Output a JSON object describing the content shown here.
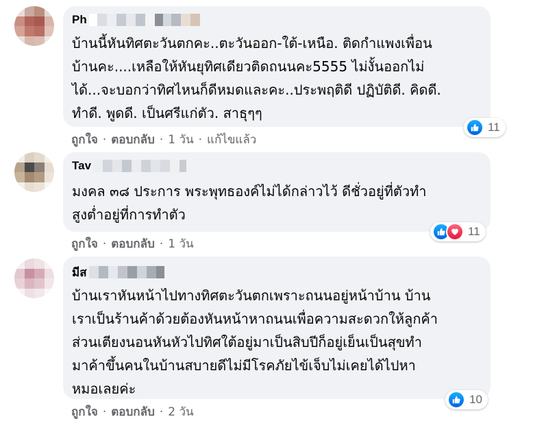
{
  "comments": [
    {
      "name": "Ph",
      "text": [
        "บ้านนี้หันทิศตะวันตกคะ..ตะวันออก-ใต้-เหนือ. ติดกำแพงเพื่อน",
        "บ้านคะ....เหลือให้หันยุทิศเดียวติดถนนคะ5555 ไม่งั้นออกไม่",
        "ได้...จะบอกว่าทิศไหนก็ดีหมดและคะ..ประพฤติดี ปฏิบัติดี. คิดดี.",
        "ทำดี. พูดดี. เป็นศรีแก่ตัว. สาธุๆๆ"
      ],
      "like_label": "ถูกใจ",
      "reply_label": "ตอบกลับ",
      "time": "1 วัน",
      "edited": "แก้ไขแล้ว",
      "reaction_count": "11",
      "reactions": [
        "like-icon"
      ]
    },
    {
      "name": "Tav",
      "text": [
        "มงคล ๓๘ ประการ พระพุทธองค์ไม่ได้กล่าวไว้ ดีชั่วอยู่ที่ตัวทำ",
        "สูงต่ำอยู่ที่การทำตัว"
      ],
      "like_label": "ถูกใจ",
      "reply_label": "ตอบกลับ",
      "time": "1 วัน",
      "reaction_count": "11",
      "reactions": [
        "like-icon",
        "love-icon"
      ]
    },
    {
      "name": "มีส",
      "text": [
        "บ้านเราหันหน้าไปทางทิศตะวันตกเพราะถนนอยู่หน้าบ้าน บ้าน",
        "เราเป็นร้านค้าด้วยต้องหันหน้าหาถนนเพื่อความสะดวกให้ลูกค้า",
        "ส่วนเตียงนอนหันหัวไปทิศใต้อยู่มาเป็นสิบปีก็อยู่เย็นเป็นสุขทำ",
        "มาค้าขึ้นคนในบ้านสบายดีไม่มีโรคภัยไข้เจ็บไม่เคยได้ไปหา",
        "หมอเลยค่ะ"
      ],
      "like_label": "ถูกใจ",
      "reply_label": "ตอบกลับ",
      "time": "2 วัน",
      "reaction_count": "10",
      "reactions": [
        "like-icon"
      ]
    }
  ],
  "dot": "·",
  "colors": {
    "bubble": "#f0f2f5",
    "meta_text": "#65676b",
    "like_blue": "#1877f2",
    "love_red": "#f33e58"
  }
}
